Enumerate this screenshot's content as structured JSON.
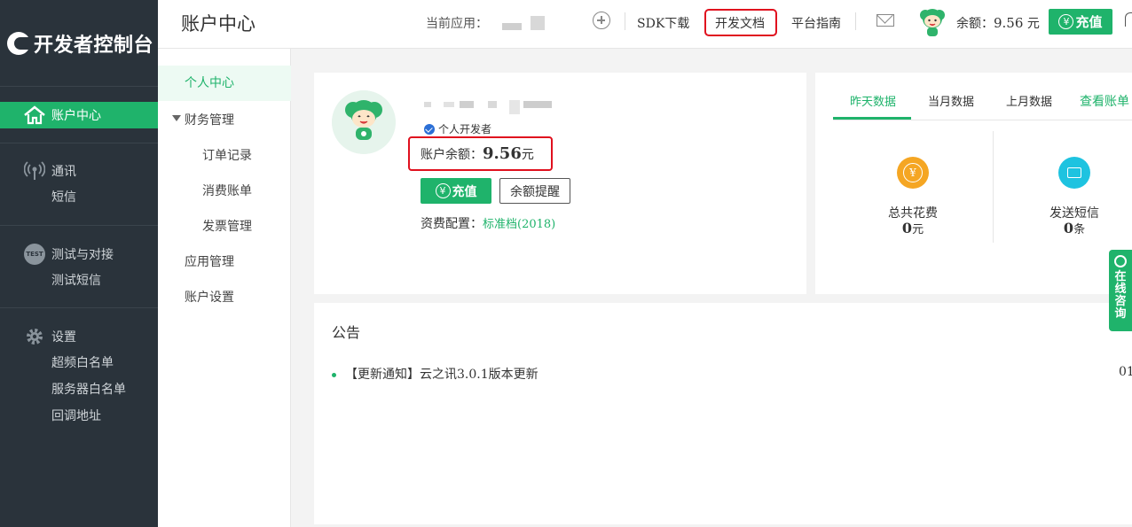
{
  "sidebar": {
    "logo_text": "开发者控制台",
    "active_item": "账户中心",
    "groups": [
      {
        "title": "通讯",
        "icon": "signal-icon",
        "items": [
          "短信"
        ]
      },
      {
        "title": "测试与对接",
        "icon": "test-icon",
        "icon_text": "TEST",
        "items": [
          "测试短信"
        ]
      },
      {
        "title": "设置",
        "icon": "gear-icon",
        "items": [
          "超频白名单",
          "服务器白名单",
          "回调地址"
        ]
      }
    ]
  },
  "header": {
    "title": "账户中心",
    "current_app_label": "当前应用：",
    "sdk_download": "SDK下载",
    "dev_docs": "开发文档",
    "platform_guide": "平台指南",
    "balance_label": "余额：",
    "balance_value": "9.56",
    "balance_unit": "元",
    "recharge": "充值"
  },
  "subnav": {
    "active": "个人中心",
    "finance": "财务管理",
    "finance_items": [
      "订单记录",
      "消费账单",
      "发票管理"
    ],
    "app_mgmt": "应用管理",
    "account_settings": "账户设置"
  },
  "profile": {
    "verify_label": "个人开发者",
    "balance_label": "账户余额：",
    "balance_value": "9.56",
    "balance_unit": "元",
    "recharge_btn": "充值",
    "alert_btn": "余额提醒",
    "plan_label": "资费配置：",
    "plan_value": "标准档(2018)"
  },
  "stats": {
    "tabs": [
      "昨天数据",
      "当月数据",
      "上月数据"
    ],
    "link": "查看账单",
    "items": [
      {
        "label": "总共花费",
        "value": "0",
        "unit": "元",
        "color": "#f5a623",
        "icon": "yen-icon"
      },
      {
        "label": "发送短信",
        "value": "0",
        "unit": "条",
        "color": "#1ec3e0",
        "icon": "mail-icon"
      }
    ]
  },
  "notice": {
    "title": "公告",
    "items": [
      {
        "text": "【更新通知】云之讯3.0.1版本更新",
        "date": "01"
      }
    ]
  },
  "consult": {
    "chars": [
      "在",
      "线",
      "咨",
      "询"
    ]
  }
}
